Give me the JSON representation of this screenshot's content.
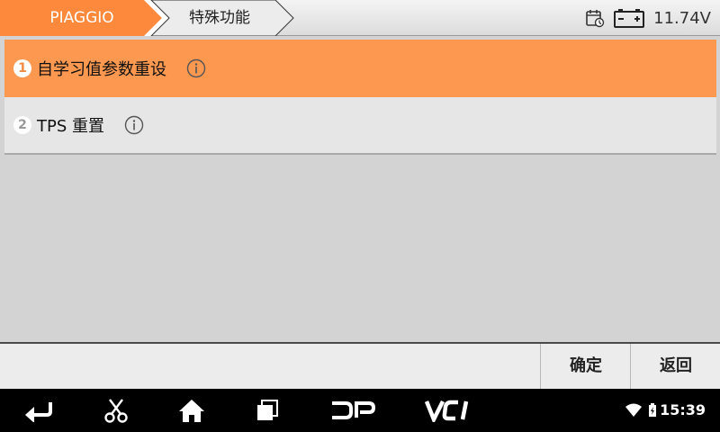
{
  "header": {
    "breadcrumbs": [
      "PIAGGIO",
      "特殊功能"
    ],
    "voltage": "11.74V",
    "icons": [
      "calendar-icon",
      "battery-icon"
    ],
    "accent": "#fd8a3c"
  },
  "list": {
    "items": [
      {
        "num": "1",
        "label": "自学习值参数重设",
        "selected": true
      },
      {
        "num": "2",
        "label": "TPS 重置",
        "selected": false
      }
    ],
    "selected_color": "#fd9850"
  },
  "actions": {
    "ok_label": "确定",
    "back_label": "返回"
  },
  "navbar": {
    "dp_label": "DP",
    "vci_label": "VCI",
    "time": "15:39",
    "icons": [
      "back-icon",
      "scissors-icon",
      "home-icon",
      "recents-icon",
      "wifi-icon",
      "battery-status-icon"
    ]
  }
}
